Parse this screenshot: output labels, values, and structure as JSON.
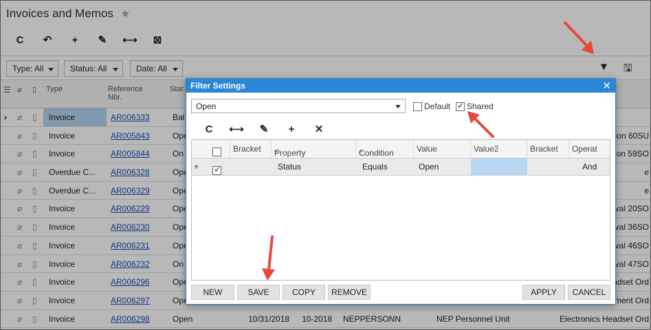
{
  "page": {
    "title": "Invoices and Memos",
    "star": "★"
  },
  "toolbar": {
    "refresh": "C",
    "undo": "↶",
    "add": "+",
    "edit": "✎",
    "fit": "⟷",
    "export": "⊠"
  },
  "header_right": {
    "filter": "▼",
    "save": "🖫"
  },
  "filters": {
    "type": "Type: All",
    "status": "Status: All",
    "date": "Date: All"
  },
  "grid": {
    "headers": {
      "type": "Type",
      "reference": "Reference Nbr.",
      "status": "Stat"
    },
    "rows": [
      {
        "type": "Invoice",
        "ref": "AR006333",
        "status": "Bal",
        "right": ""
      },
      {
        "type": "Invoice",
        "ref": "AR005843",
        "status": "Ope",
        "right": "ion 60SU"
      },
      {
        "type": "Invoice",
        "ref": "AR005844",
        "status": "On",
        "right": "ion 59SO"
      },
      {
        "type": "Overdue C...",
        "ref": "AR006328",
        "status": "Ope",
        "right": "e"
      },
      {
        "type": "Overdue C...",
        "ref": "AR006329",
        "status": "Ope",
        "right": "e"
      },
      {
        "type": "Invoice",
        "ref": "AR006229",
        "status": "Ope",
        "right": "val 20SO"
      },
      {
        "type": "Invoice",
        "ref": "AR006230",
        "status": "Ope",
        "right": "val 36SO"
      },
      {
        "type": "Invoice",
        "ref": "AR006231",
        "status": "Ope",
        "right": "val 46SO"
      },
      {
        "type": "Invoice",
        "ref": "AR006232",
        "status": "On",
        "right": "val 47SO"
      },
      {
        "type": "Invoice",
        "ref": "AR006296",
        "status": "Ope",
        "right": "adset Ord"
      },
      {
        "type": "Invoice",
        "ref": "AR006297",
        "status": "Ope",
        "right": "ement Ord"
      },
      {
        "type": "Invoice",
        "ref": "AR006298",
        "status": "Open",
        "date": "10/31/2018",
        "period": "10-2018",
        "customer": "NEPPERSONN",
        "desc": "NEP Personnel Unit",
        "right": "Electronics Headset Ord"
      }
    ]
  },
  "dialog": {
    "title": "Filter Settings",
    "close": "✕",
    "filter_name": "Open",
    "default_label": "Default",
    "shared_label": "Shared",
    "toolbar": {
      "refresh": "C",
      "fit": "⟷",
      "edit": "✎",
      "add": "+",
      "delete": "✕"
    },
    "columns": {
      "bracket": "Bracket",
      "property": "Property",
      "condition": "Condition",
      "value": "Value",
      "value2": "Value2",
      "bracket2": "Bracket",
      "operator": "Operat"
    },
    "required_mark": "*",
    "row": {
      "add": "+",
      "property": "Status",
      "condition": "Equals",
      "value": "Open",
      "operator": "And"
    },
    "buttons": {
      "new": "NEW",
      "save": "SAVE",
      "copy": "COPY",
      "remove": "REMOVE",
      "apply": "APPLY",
      "cancel": "CANCEL"
    }
  },
  "colors": {
    "dialog_title_bg": "#2b86d8",
    "link": "#1a4fb8",
    "arrow": "#e8483a",
    "selected_cell": "#b8d7f2"
  }
}
